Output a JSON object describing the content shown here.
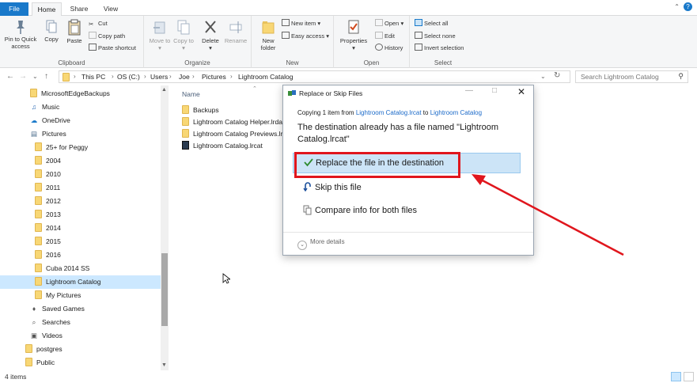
{
  "ribbon_tabs": {
    "file": "File",
    "home": "Home",
    "share": "Share",
    "view": "View"
  },
  "clipboard": {
    "pin": "Pin to Quick access",
    "copy": "Copy",
    "paste": "Paste",
    "cut": "Cut",
    "copy_path": "Copy path",
    "paste_shortcut": "Paste shortcut",
    "label": "Clipboard"
  },
  "organize": {
    "move_to": "Move to",
    "copy_to": "Copy to",
    "delete": "Delete",
    "rename": "Rename",
    "label": "Organize"
  },
  "new_group": {
    "new_folder": "New folder",
    "new_item": "New item",
    "easy_access": "Easy access",
    "label": "New"
  },
  "open_group": {
    "properties": "Properties",
    "open": "Open",
    "edit": "Edit",
    "history": "History",
    "label": "Open"
  },
  "select_group": {
    "select_all": "Select all",
    "select_none": "Select none",
    "invert": "Invert selection",
    "label": "Select"
  },
  "breadcrumb": [
    "This PC",
    "OS (C:)",
    "Users",
    "Joe",
    "Pictures",
    "Lightroom Catalog"
  ],
  "search": {
    "placeholder": "Search Lightroom Catalog"
  },
  "nav_items": [
    {
      "label": "MicrosoftEdgeBackups",
      "icon": "folder-icon"
    },
    {
      "label": "Music",
      "icon": "music-icon"
    },
    {
      "label": "OneDrive",
      "icon": "cloud-icon"
    },
    {
      "label": "Pictures",
      "icon": "pictures-icon"
    },
    {
      "label": "25+ for Peggy",
      "icon": "folder-icon"
    },
    {
      "label": "2004",
      "icon": "folder-icon"
    },
    {
      "label": "2010",
      "icon": "folder-icon"
    },
    {
      "label": "2011",
      "icon": "folder-icon"
    },
    {
      "label": "2012",
      "icon": "folder-icon"
    },
    {
      "label": "2013",
      "icon": "folder-icon"
    },
    {
      "label": "2014",
      "icon": "folder-icon"
    },
    {
      "label": "2015",
      "icon": "folder-icon"
    },
    {
      "label": "2016",
      "icon": "folder-icon"
    },
    {
      "label": "Cuba 2014 SS",
      "icon": "folder-icon"
    },
    {
      "label": "Lightroom Catalog",
      "icon": "folder-icon"
    },
    {
      "label": "My Pictures",
      "icon": "folder-icon"
    },
    {
      "label": "Saved Games",
      "icon": "saved-games-icon"
    },
    {
      "label": "Searches",
      "icon": "search-icon"
    },
    {
      "label": "Videos",
      "icon": "videos-icon"
    },
    {
      "label": "postgres",
      "icon": "folder-icon"
    },
    {
      "label": "Public",
      "icon": "folder-icon"
    }
  ],
  "content": {
    "column_name": "Name",
    "files": [
      {
        "name": "Backups",
        "icon": "folder-icon"
      },
      {
        "name": "Lightroom Catalog Helper.lrdata",
        "icon": "folder-icon"
      },
      {
        "name": "Lightroom Catalog Previews.lrdata",
        "icon": "folder-icon"
      },
      {
        "name": "Lightroom Catalog.lrcat",
        "icon": "lrcat-file-icon"
      }
    ]
  },
  "status": {
    "item_count": "4 items"
  },
  "dialog": {
    "title": "Replace or Skip Files",
    "copying_prefix": "Copying 1 item from",
    "source": "Lightroom Catalog.lrcat",
    "to": "to",
    "destination": "Lightroom Catalog",
    "message": "The destination already has a file named \"Lightroom Catalog.lrcat\"",
    "replace": "Replace the file in the destination",
    "skip": "Skip this file",
    "compare": "Compare info for both files",
    "more_details": "More details"
  },
  "colors": {
    "accent": "#1979ca",
    "highlight": "#cce4f7",
    "annotation": "#e0161d"
  }
}
